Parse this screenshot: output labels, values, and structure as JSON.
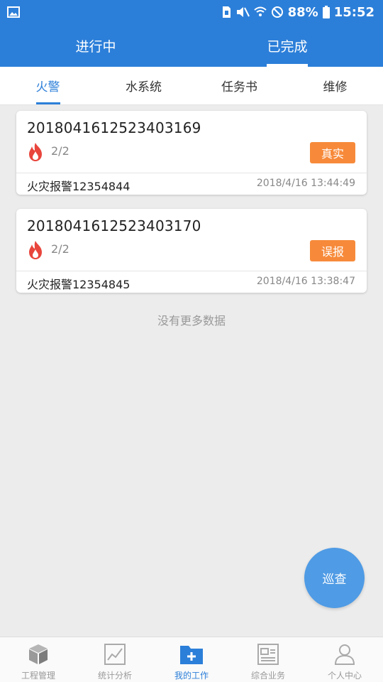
{
  "status_bar": {
    "battery": "88%",
    "time": "15:52",
    "icons": [
      "image-icon",
      "sim-icon",
      "mute-icon",
      "wifi-icon",
      "dnd-icon",
      "battery-icon"
    ]
  },
  "top_tabs": [
    {
      "label": "进行中",
      "active": false
    },
    {
      "label": "已完成",
      "active": true
    }
  ],
  "sub_tabs": [
    {
      "label": "火警",
      "active": true
    },
    {
      "label": "水系统",
      "active": false
    },
    {
      "label": "任务书",
      "active": false
    },
    {
      "label": "维修",
      "active": false
    }
  ],
  "records": [
    {
      "id": "2018041612523403169",
      "count": "2/2",
      "badge": "真实",
      "name": "火灾报警12354844",
      "time": "2018/4/16 13:44:49"
    },
    {
      "id": "2018041612523403170",
      "count": "2/2",
      "badge": "误报",
      "name": "火灾报警12354845",
      "time": "2018/4/16 13:38:47"
    }
  ],
  "no_more_text": "没有更多数据",
  "fab_label": "巡查",
  "bottom_nav": [
    {
      "label": "工程管理",
      "icon": "cube-icon",
      "active": false
    },
    {
      "label": "统计分析",
      "icon": "line-chart-icon",
      "active": false
    },
    {
      "label": "我的工作",
      "icon": "folder-add-icon",
      "active": true
    },
    {
      "label": "综合业务",
      "icon": "document-icon",
      "active": false
    },
    {
      "label": "个人中心",
      "icon": "person-icon",
      "active": false
    }
  ],
  "colors": {
    "primary": "#2c7fd9",
    "badge": "#f78a3a",
    "fire": "#e8453c",
    "background": "#ececec"
  }
}
